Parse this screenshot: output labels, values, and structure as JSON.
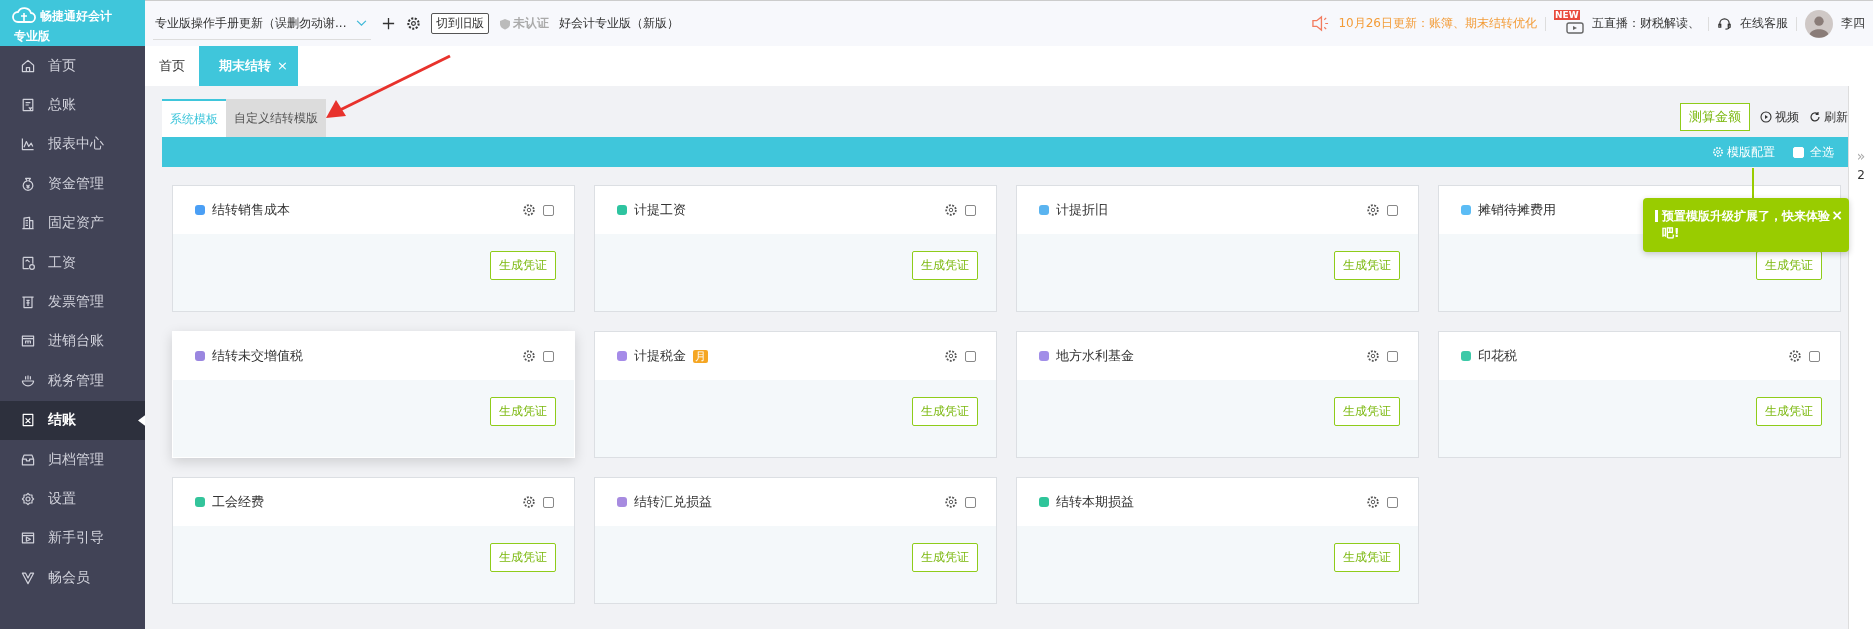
{
  "logo": {
    "name": "畅捷通好会计",
    "edition": "专业版"
  },
  "top_bar": {
    "notice_select": "专业版操作手册更新（误删勿动谢...",
    "switch_button": "切到旧版",
    "certification": "未认证",
    "product": "好会计专业版（新版）",
    "update_notice": "10月26日更新：账簿、期末结转优化",
    "live_badge": "NEW",
    "live": "五直播：财税解读、",
    "support": "在线客服",
    "user": "李四"
  },
  "sidebar": {
    "items": [
      {
        "label": "首页",
        "selected": false
      },
      {
        "label": "总账",
        "selected": false
      },
      {
        "label": "报表中心",
        "selected": false
      },
      {
        "label": "资金管理",
        "selected": false
      },
      {
        "label": "固定资产",
        "selected": false
      },
      {
        "label": "工资",
        "selected": false
      },
      {
        "label": "发票管理",
        "selected": false
      },
      {
        "label": "进销台账",
        "selected": false
      },
      {
        "label": "税务管理",
        "selected": false
      },
      {
        "label": "结账",
        "selected": true
      },
      {
        "label": "归档管理",
        "selected": false
      },
      {
        "label": "设置",
        "selected": false
      },
      {
        "label": "新手引导",
        "selected": false
      },
      {
        "label": "畅会员",
        "selected": false
      }
    ]
  },
  "tabs": [
    {
      "label": "首页",
      "selected": false
    },
    {
      "label": "期末结转",
      "selected": true,
      "close": "×"
    }
  ],
  "template_tabs": [
    {
      "label": "系统模板",
      "selected": true
    },
    {
      "label": "自定义结转模版",
      "selected": false
    }
  ],
  "actions": {
    "estimate": "测算金额",
    "video": "视频",
    "refresh": "刷新"
  },
  "bar": {
    "config": "模版配置",
    "select_all": {
      "label": "全选",
      "checked": false
    }
  },
  "cards": [
    {
      "title": "结转销售成本",
      "color": "#4a9ff5",
      "checked": false,
      "raised": false,
      "button": "生成凭证"
    },
    {
      "title": "计提工资",
      "color": "#2ec4a0",
      "checked": false,
      "raised": false,
      "button": "生成凭证"
    },
    {
      "title": "计提折旧",
      "color": "#5ab4f0",
      "checked": false,
      "raised": false,
      "button": "生成凭证"
    },
    {
      "title": "摊销待摊费用",
      "color": "#5bbcf5",
      "raised": false,
      "button": "生成凭证"
    },
    {
      "title": "结转未交增值税",
      "color": "#9a86e0",
      "checked": false,
      "raised": true,
      "button": "生成凭证"
    },
    {
      "title": "计提税金",
      "color": "#a58be8",
      "checked": false,
      "raised": false,
      "badge": "月",
      "button": "生成凭证"
    },
    {
      "title": "地方水利基金",
      "color": "#a18ee8",
      "checked": false,
      "raised": false,
      "button": "生成凭证"
    },
    {
      "title": "印花税",
      "color": "#3cc9a8",
      "checked": false,
      "raised": false,
      "button": "生成凭证"
    },
    {
      "title": "工会经费",
      "color": "#33c49b",
      "checked": false,
      "raised": false,
      "button": "生成凭证"
    },
    {
      "title": "结转汇兑损益",
      "color": "#a78be0",
      "checked": false,
      "raised": false,
      "button": "生成凭证"
    },
    {
      "title": "结转本期损益",
      "color": "#2fc59a",
      "checked": false,
      "raised": false,
      "button": "生成凭证"
    }
  ],
  "tooltip": {
    "text": "预置模版升级扩展了，快来体验吧!",
    "close": "×"
  },
  "edge": {
    "collapse": "»",
    "value": "2"
  }
}
